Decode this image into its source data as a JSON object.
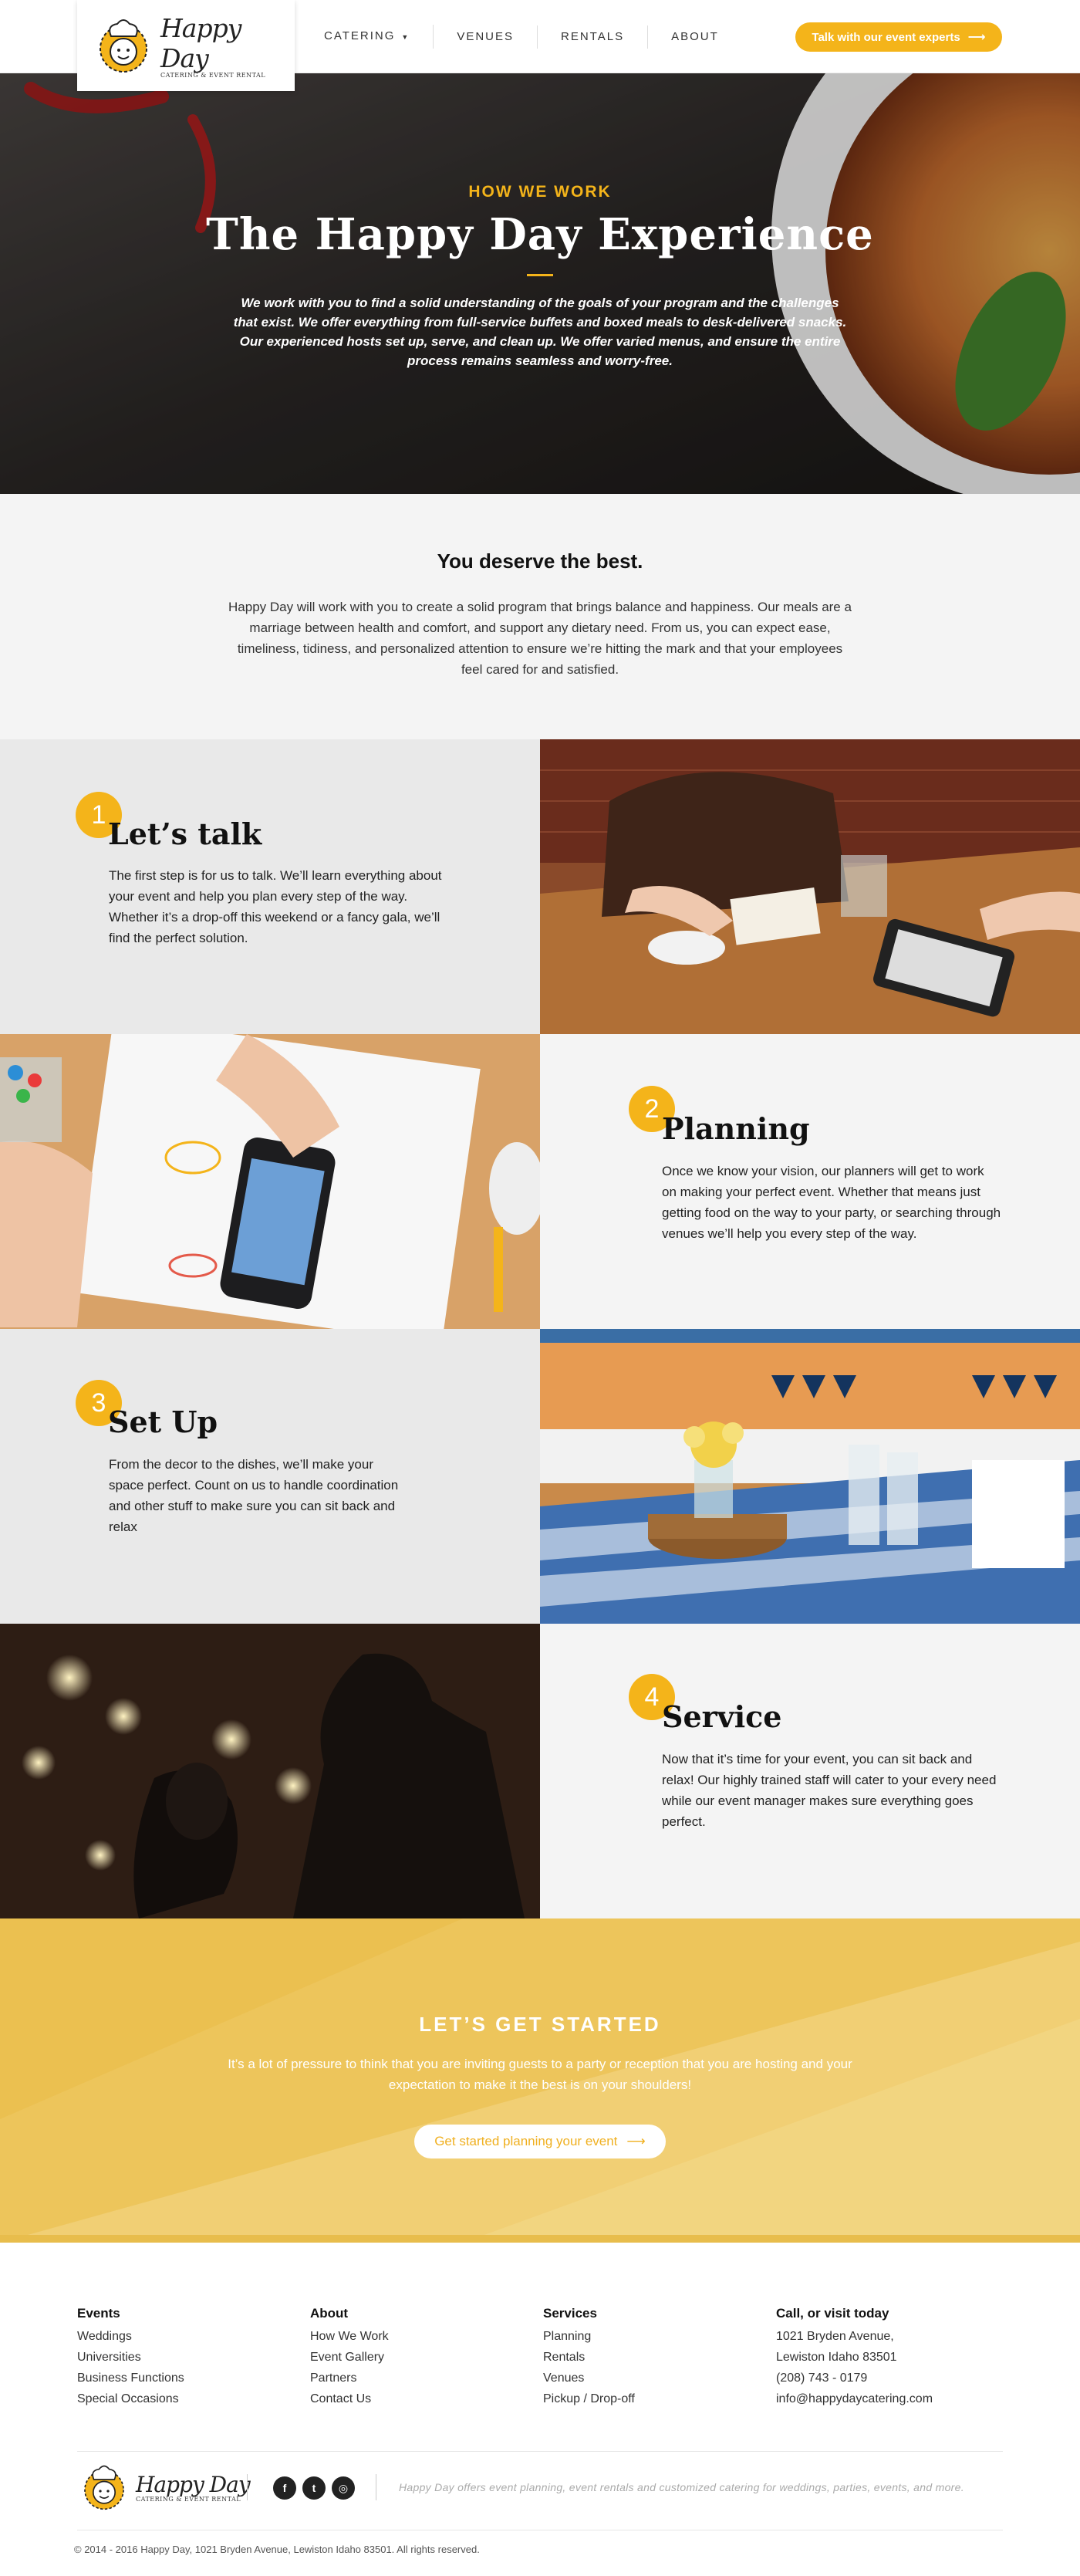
{
  "brand": {
    "name": "Happy Day",
    "tagline": "CATERING & EVENT RENTAL"
  },
  "nav": {
    "items": [
      "CATERING",
      "VENUES",
      "RENTALS",
      "ABOUT"
    ],
    "cta": "Talk with our event experts"
  },
  "hero": {
    "eyebrow": "HOW WE WORK",
    "title": "The Happy Day Experience",
    "text": "We work with you to find a solid understanding of the goals of your program and the challenges that exist. We offer everything from full-service buffets and boxed meals to desk-delivered snacks. Our experienced hosts set up, serve, and clean up. We offer varied menus, and ensure the entire process remains seamless and worry-free."
  },
  "intro": {
    "heading": "You deserve the best.",
    "text": "Happy Day will work with you to create a solid program that brings balance and happiness. Our meals are a marriage between health and comfort, and support any dietary need. From us, you can expect ease, timeliness, tidiness, and personalized attention to ensure we’re hitting the mark and that your employees feel cared for and satisfied."
  },
  "steps": [
    {
      "number": "1",
      "title": "Let’s talk",
      "text": "The first step is for us to talk. We’ll learn everything about your event and help you plan every step of the way. Whether it’s a drop-off this weekend or a fancy gala, we’ll find the perfect solution."
    },
    {
      "number": "2",
      "title": "Planning",
      "text": "Once we know your vision, our planners will get to work on making your perfect event. Whether that means just getting food on the way to your party, or searching through venues we’ll help you every step of the way."
    },
    {
      "number": "3",
      "title": "Set Up",
      "text": "From the decor to the dishes, we’ll make your space perfect. Count on us to handle coordination and other stuff to make sure you can sit back and relax"
    },
    {
      "number": "4",
      "title": "Service",
      "text": "Now that it’s time for your event, you can sit back and relax! Our highly trained staff will cater to your every need while our event manager makes sure everything goes perfect."
    }
  ],
  "started": {
    "heading": "LET’S GET STARTED",
    "text": "It’s a lot of pressure to think that you are inviting guests to a party or reception that you are hosting and your expectation to make it the best is on your shoulders!",
    "button": "Get started planning your event"
  },
  "footer": {
    "columns": [
      {
        "title": "Events",
        "links": [
          "Weddings",
          "Universities",
          "Business Functions",
          "Special Occasions"
        ]
      },
      {
        "title": "About",
        "links": [
          "How We Work",
          "Event Gallery",
          "Partners",
          "Contact Us"
        ]
      },
      {
        "title": "Services",
        "links": [
          "Planning",
          "Rentals",
          "Venues",
          "Pickup / Drop-off"
        ]
      },
      {
        "title": "Call, or visit today",
        "links": [
          "1021 Bryden Avenue,",
          "Lewiston Idaho 83501",
          "(208) 743 - 0179",
          "info@happydaycatering.com"
        ]
      }
    ],
    "social": [
      "facebook-icon",
      "twitter-icon",
      "instagram-icon"
    ],
    "tagline": "Happy Day offers event planning, event rentals and customized catering for  weddings, parties, events, and more.",
    "copyright": "© 2014 - 2016 Happy Day, 1021 Bryden Avenue, Lewiston Idaho 83501. All rights reserved."
  },
  "colors": {
    "accent": "#f4b41a",
    "started_bg": "#edc45a"
  }
}
